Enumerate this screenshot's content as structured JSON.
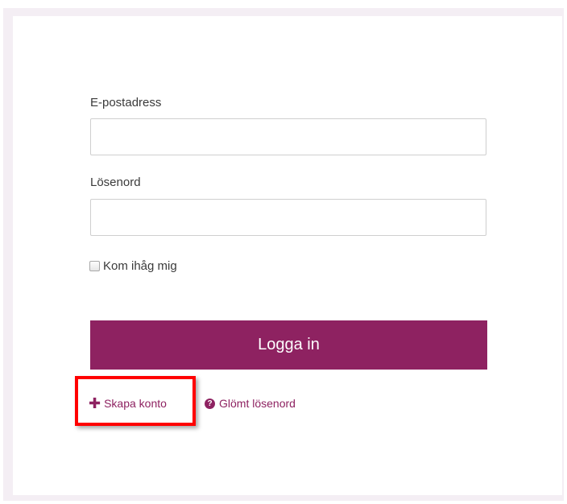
{
  "form": {
    "email_label": "E-postadress",
    "email_value": "",
    "email_placeholder": "",
    "password_label": "Lösenord",
    "password_value": "",
    "password_placeholder": "",
    "remember_label": "Kom ihåg mig",
    "remember_checked": false,
    "login_button": "Logga in"
  },
  "links": {
    "create_account": "Skapa konto",
    "create_account_icon": "plus-icon",
    "forgot_password": "Glömt lösenord",
    "forgot_password_icon": "question-circle-icon"
  },
  "colors": {
    "accent": "#8e2261",
    "highlight": "#ff0000",
    "frame_background": "#f4eef4"
  }
}
